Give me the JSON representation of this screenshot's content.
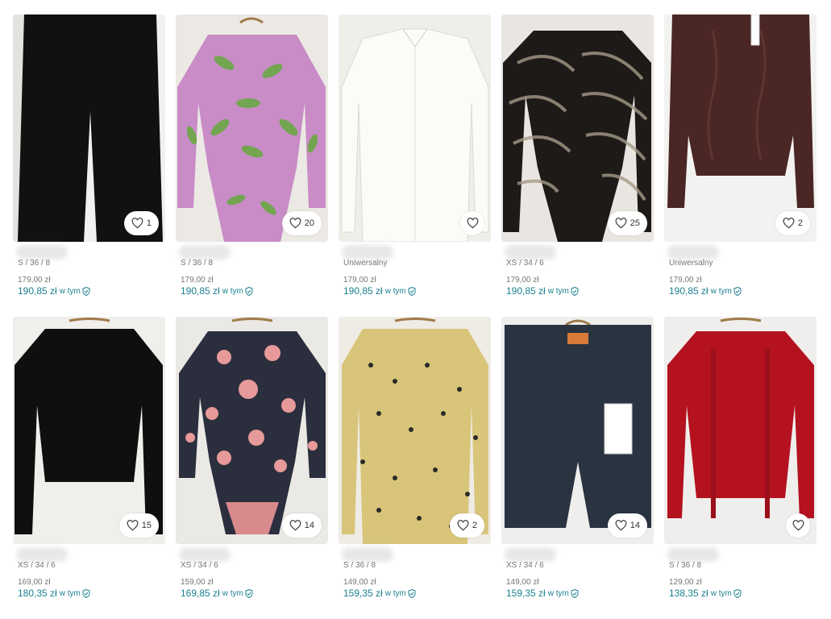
{
  "items": [
    {
      "size": "S / 36 / 8",
      "price": "179,00 zł",
      "total": "190,85 zł",
      "incl": "w tym",
      "likes": "1",
      "photo": "pants"
    },
    {
      "size": "S / 36 / 8",
      "price": "179,00 zł",
      "total": "190,85 zł",
      "incl": "w tym",
      "likes": "20",
      "photo": "body-green"
    },
    {
      "size": "Uniwersalny",
      "price": "179,00 zł",
      "total": "190,85 zł",
      "incl": "w tym",
      "likes": "",
      "photo": "white-shirt"
    },
    {
      "size": "XS / 34 / 6",
      "price": "179,00 zł",
      "total": "190,85 zł",
      "incl": "w tym",
      "likes": "25",
      "photo": "zebra-body"
    },
    {
      "size": "Uniwersalny",
      "price": "179,00 zł",
      "total": "190,85 zł",
      "incl": "w tym",
      "likes": "2",
      "photo": "brown-sweater"
    },
    {
      "size": "XS / 34 / 6",
      "price": "169,00 zł",
      "total": "180,35 zł",
      "incl": "w tym",
      "likes": "15",
      "photo": "black-top"
    },
    {
      "size": "XS / 34 / 6",
      "price": "159,00 zł",
      "total": "169,85 zł",
      "incl": "w tym",
      "likes": "14",
      "photo": "floral-body"
    },
    {
      "size": "S / 36 / 8",
      "price": "149,00 zł",
      "total": "159,35 zł",
      "incl": "w tym",
      "likes": "2",
      "photo": "leopard-blouse"
    },
    {
      "size": "XS / 34 / 6",
      "price": "149,00 zł",
      "total": "159,35 zł",
      "incl": "w tym",
      "likes": "14",
      "photo": "denim-shorts"
    },
    {
      "size": "S / 36 / 8",
      "price": "129,00 zł",
      "total": "138,35 zł",
      "incl": "w tym",
      "likes": "",
      "photo": "red-cardigan"
    }
  ],
  "colors": {
    "accent": "#1a7f8e",
    "muted": "#777777"
  }
}
